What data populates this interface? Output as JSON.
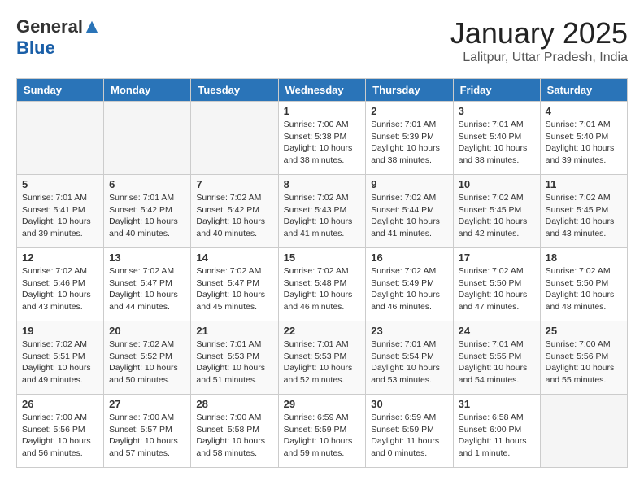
{
  "logo": {
    "general": "General",
    "blue": "Blue"
  },
  "title": "January 2025",
  "subtitle": "Lalitpur, Uttar Pradesh, India",
  "weekdays": [
    "Sunday",
    "Monday",
    "Tuesday",
    "Wednesday",
    "Thursday",
    "Friday",
    "Saturday"
  ],
  "weeks": [
    [
      {
        "day": "",
        "info": ""
      },
      {
        "day": "",
        "info": ""
      },
      {
        "day": "",
        "info": ""
      },
      {
        "day": "1",
        "info": "Sunrise: 7:00 AM\nSunset: 5:38 PM\nDaylight: 10 hours\nand 38 minutes."
      },
      {
        "day": "2",
        "info": "Sunrise: 7:01 AM\nSunset: 5:39 PM\nDaylight: 10 hours\nand 38 minutes."
      },
      {
        "day": "3",
        "info": "Sunrise: 7:01 AM\nSunset: 5:40 PM\nDaylight: 10 hours\nand 38 minutes."
      },
      {
        "day": "4",
        "info": "Sunrise: 7:01 AM\nSunset: 5:40 PM\nDaylight: 10 hours\nand 39 minutes."
      }
    ],
    [
      {
        "day": "5",
        "info": "Sunrise: 7:01 AM\nSunset: 5:41 PM\nDaylight: 10 hours\nand 39 minutes."
      },
      {
        "day": "6",
        "info": "Sunrise: 7:01 AM\nSunset: 5:42 PM\nDaylight: 10 hours\nand 40 minutes."
      },
      {
        "day": "7",
        "info": "Sunrise: 7:02 AM\nSunset: 5:42 PM\nDaylight: 10 hours\nand 40 minutes."
      },
      {
        "day": "8",
        "info": "Sunrise: 7:02 AM\nSunset: 5:43 PM\nDaylight: 10 hours\nand 41 minutes."
      },
      {
        "day": "9",
        "info": "Sunrise: 7:02 AM\nSunset: 5:44 PM\nDaylight: 10 hours\nand 41 minutes."
      },
      {
        "day": "10",
        "info": "Sunrise: 7:02 AM\nSunset: 5:45 PM\nDaylight: 10 hours\nand 42 minutes."
      },
      {
        "day": "11",
        "info": "Sunrise: 7:02 AM\nSunset: 5:45 PM\nDaylight: 10 hours\nand 43 minutes."
      }
    ],
    [
      {
        "day": "12",
        "info": "Sunrise: 7:02 AM\nSunset: 5:46 PM\nDaylight: 10 hours\nand 43 minutes."
      },
      {
        "day": "13",
        "info": "Sunrise: 7:02 AM\nSunset: 5:47 PM\nDaylight: 10 hours\nand 44 minutes."
      },
      {
        "day": "14",
        "info": "Sunrise: 7:02 AM\nSunset: 5:47 PM\nDaylight: 10 hours\nand 45 minutes."
      },
      {
        "day": "15",
        "info": "Sunrise: 7:02 AM\nSunset: 5:48 PM\nDaylight: 10 hours\nand 46 minutes."
      },
      {
        "day": "16",
        "info": "Sunrise: 7:02 AM\nSunset: 5:49 PM\nDaylight: 10 hours\nand 46 minutes."
      },
      {
        "day": "17",
        "info": "Sunrise: 7:02 AM\nSunset: 5:50 PM\nDaylight: 10 hours\nand 47 minutes."
      },
      {
        "day": "18",
        "info": "Sunrise: 7:02 AM\nSunset: 5:50 PM\nDaylight: 10 hours\nand 48 minutes."
      }
    ],
    [
      {
        "day": "19",
        "info": "Sunrise: 7:02 AM\nSunset: 5:51 PM\nDaylight: 10 hours\nand 49 minutes."
      },
      {
        "day": "20",
        "info": "Sunrise: 7:02 AM\nSunset: 5:52 PM\nDaylight: 10 hours\nand 50 minutes."
      },
      {
        "day": "21",
        "info": "Sunrise: 7:01 AM\nSunset: 5:53 PM\nDaylight: 10 hours\nand 51 minutes."
      },
      {
        "day": "22",
        "info": "Sunrise: 7:01 AM\nSunset: 5:53 PM\nDaylight: 10 hours\nand 52 minutes."
      },
      {
        "day": "23",
        "info": "Sunrise: 7:01 AM\nSunset: 5:54 PM\nDaylight: 10 hours\nand 53 minutes."
      },
      {
        "day": "24",
        "info": "Sunrise: 7:01 AM\nSunset: 5:55 PM\nDaylight: 10 hours\nand 54 minutes."
      },
      {
        "day": "25",
        "info": "Sunrise: 7:00 AM\nSunset: 5:56 PM\nDaylight: 10 hours\nand 55 minutes."
      }
    ],
    [
      {
        "day": "26",
        "info": "Sunrise: 7:00 AM\nSunset: 5:56 PM\nDaylight: 10 hours\nand 56 minutes."
      },
      {
        "day": "27",
        "info": "Sunrise: 7:00 AM\nSunset: 5:57 PM\nDaylight: 10 hours\nand 57 minutes."
      },
      {
        "day": "28",
        "info": "Sunrise: 7:00 AM\nSunset: 5:58 PM\nDaylight: 10 hours\nand 58 minutes."
      },
      {
        "day": "29",
        "info": "Sunrise: 6:59 AM\nSunset: 5:59 PM\nDaylight: 10 hours\nand 59 minutes."
      },
      {
        "day": "30",
        "info": "Sunrise: 6:59 AM\nSunset: 5:59 PM\nDaylight: 11 hours\nand 0 minutes."
      },
      {
        "day": "31",
        "info": "Sunrise: 6:58 AM\nSunset: 6:00 PM\nDaylight: 11 hours\nand 1 minute."
      },
      {
        "day": "",
        "info": ""
      }
    ]
  ]
}
